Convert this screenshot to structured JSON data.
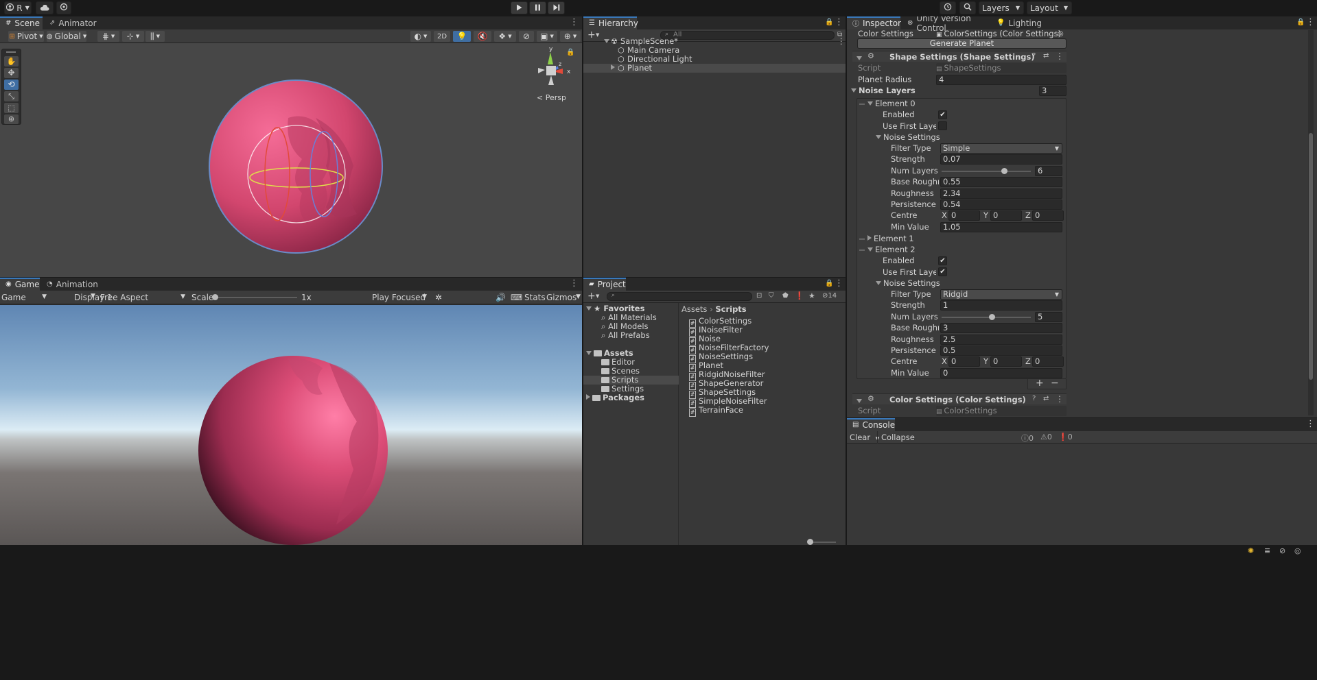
{
  "toolbar": {
    "account_label": "R",
    "play_icon": "play-icon",
    "pause_icon": "pause-icon",
    "step_icon": "step-icon",
    "layers_label": "Layers",
    "layout_label": "Layout"
  },
  "scene": {
    "tabs": [
      {
        "label": "Scene"
      },
      {
        "label": "Animator"
      }
    ],
    "pivot_label": "Pivot",
    "global_label": "Global",
    "mode_2d_label": "2D",
    "persp_label": "Persp",
    "gizmo_axes": {
      "y": "y",
      "x": "x",
      "z": "z"
    }
  },
  "game": {
    "tabs": [
      {
        "label": "Game"
      },
      {
        "label": "Animation"
      }
    ],
    "game_dropdown": "Game",
    "display_dropdown": "Display 1",
    "aspect_dropdown": "Free Aspect",
    "scale_label": "Scale",
    "scale_value": "1x",
    "scale_fraction": 0.0,
    "play_mode_dropdown": "Play Focused",
    "stats_label": "Stats",
    "gizmos_label": "Gizmos"
  },
  "hierarchy": {
    "tab_label": "Hierarchy",
    "search_placeholder": "All",
    "scene_name": "SampleScene*",
    "items": [
      {
        "label": "Main Camera"
      },
      {
        "label": "Directional Light"
      },
      {
        "label": "Planet"
      }
    ]
  },
  "project": {
    "tab_label": "Project",
    "hidden_count": "14",
    "favorites": {
      "label": "Favorites",
      "items": [
        {
          "label": "All Materials"
        },
        {
          "label": "All Models"
        },
        {
          "label": "All Prefabs"
        }
      ]
    },
    "assets": {
      "label": "Assets",
      "folders": [
        {
          "label": "Editor"
        },
        {
          "label": "Scenes"
        },
        {
          "label": "Scripts"
        },
        {
          "label": "Settings"
        }
      ]
    },
    "packages_label": "Packages",
    "breadcrumb": {
      "root": "Assets",
      "current": "Scripts"
    },
    "files": [
      {
        "label": "ColorSettings"
      },
      {
        "label": "INoiseFilter"
      },
      {
        "label": "Noise"
      },
      {
        "label": "NoiseFilterFactory"
      },
      {
        "label": "NoiseSettings"
      },
      {
        "label": "Planet"
      },
      {
        "label": "RidgidNoiseFilter"
      },
      {
        "label": "ShapeGenerator"
      },
      {
        "label": "ShapeSettings"
      },
      {
        "label": "SimpleNoiseFilter"
      },
      {
        "label": "TerrainFace"
      }
    ]
  },
  "inspector": {
    "tabs": [
      {
        "label": "Inspector"
      },
      {
        "label": "Unity Version Control"
      },
      {
        "label": "Lighting"
      }
    ],
    "color_settings_label": "Color Settings",
    "color_settings_value": "ColorSettings (Color Settings)",
    "generate_button": "Generate Planet",
    "shape_header": "Shape Settings (Shape Settings)",
    "script_label": "Script",
    "script_value": "ShapeSettings",
    "planet_radius_label": "Planet Radius",
    "planet_radius_value": "4",
    "noise_layers_label": "Noise Layers",
    "noise_layers_count": "3",
    "element0": {
      "label": "Element 0",
      "enabled_label": "Enabled",
      "enabled": true,
      "use_first_label": "Use First Layer As",
      "use_first": false,
      "noise_settings_label": "Noise Settings",
      "filter_type_label": "Filter Type",
      "filter_type": "Simple",
      "strength_label": "Strength",
      "strength": "0.07",
      "num_layers_label": "Num Layers",
      "num_layers": "6",
      "num_layers_fraction": 0.7,
      "base_roughness_label": "Base Roughnes",
      "base_roughness": "0.55",
      "roughness_label": "Roughness",
      "roughness": "2.34",
      "persistence_label": "Persistence",
      "persistence": "0.54",
      "centre_label": "Centre",
      "centre": {
        "x": "0",
        "y": "0",
        "z": "0"
      },
      "min_value_label": "Min Value",
      "min_value": "1.05"
    },
    "element1": {
      "label": "Element 1"
    },
    "element2": {
      "label": "Element 2",
      "enabled_label": "Enabled",
      "enabled": true,
      "use_first_label": "Use First Layer As",
      "use_first": true,
      "noise_settings_label": "Noise Settings",
      "filter_type_label": "Filter Type",
      "filter_type": "Ridgid",
      "strength_label": "Strength",
      "strength": "1",
      "num_layers_label": "Num Layers",
      "num_layers": "5",
      "num_layers_fraction": 0.56,
      "base_roughness_label": "Base Roughnes",
      "base_roughness": "3",
      "roughness_label": "Roughness",
      "roughness": "2.5",
      "persistence_label": "Persistence",
      "persistence": "0.5",
      "centre_label": "Centre",
      "centre": {
        "x": "0",
        "y": "0",
        "z": "0"
      },
      "min_value_label": "Min Value",
      "min_value": "0"
    },
    "axis_labels": {
      "x": "X",
      "y": "Y",
      "z": "Z"
    },
    "color_header": "Color Settings (Color Settings)",
    "color_script_value": "ColorSettings"
  },
  "console": {
    "tab_label": "Console",
    "clear_label": "Clear",
    "collapse_label": "Collapse",
    "log_count": "0",
    "warn_count": "0",
    "error_count": "0"
  },
  "colors": {
    "accent": "#3a79bb",
    "planet": "#d2466e",
    "sky_top": "#5f86b3",
    "sky_horizon": "#dcecf5",
    "ground": "#5a5655"
  }
}
